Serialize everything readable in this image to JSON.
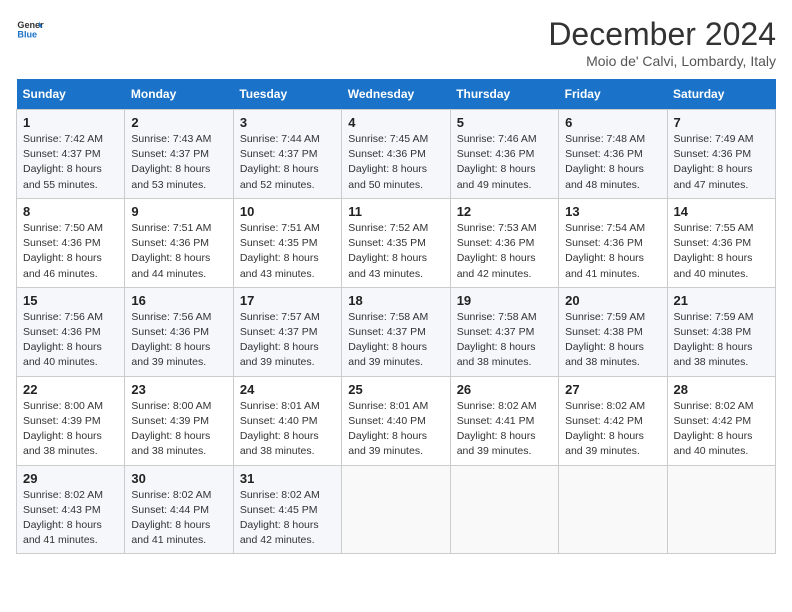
{
  "header": {
    "logo_line1": "General",
    "logo_line2": "Blue",
    "month": "December 2024",
    "location": "Moio de' Calvi, Lombardy, Italy"
  },
  "weekdays": [
    "Sunday",
    "Monday",
    "Tuesday",
    "Wednesday",
    "Thursday",
    "Friday",
    "Saturday"
  ],
  "weeks": [
    [
      {
        "day": "1",
        "sunrise": "7:42 AM",
        "sunset": "4:37 PM",
        "daylight": "8 hours and 55 minutes."
      },
      {
        "day": "2",
        "sunrise": "7:43 AM",
        "sunset": "4:37 PM",
        "daylight": "8 hours and 53 minutes."
      },
      {
        "day": "3",
        "sunrise": "7:44 AM",
        "sunset": "4:37 PM",
        "daylight": "8 hours and 52 minutes."
      },
      {
        "day": "4",
        "sunrise": "7:45 AM",
        "sunset": "4:36 PM",
        "daylight": "8 hours and 50 minutes."
      },
      {
        "day": "5",
        "sunrise": "7:46 AM",
        "sunset": "4:36 PM",
        "daylight": "8 hours and 49 minutes."
      },
      {
        "day": "6",
        "sunrise": "7:48 AM",
        "sunset": "4:36 PM",
        "daylight": "8 hours and 48 minutes."
      },
      {
        "day": "7",
        "sunrise": "7:49 AM",
        "sunset": "4:36 PM",
        "daylight": "8 hours and 47 minutes."
      }
    ],
    [
      {
        "day": "8",
        "sunrise": "7:50 AM",
        "sunset": "4:36 PM",
        "daylight": "8 hours and 46 minutes."
      },
      {
        "day": "9",
        "sunrise": "7:51 AM",
        "sunset": "4:36 PM",
        "daylight": "8 hours and 44 minutes."
      },
      {
        "day": "10",
        "sunrise": "7:51 AM",
        "sunset": "4:35 PM",
        "daylight": "8 hours and 43 minutes."
      },
      {
        "day": "11",
        "sunrise": "7:52 AM",
        "sunset": "4:35 PM",
        "daylight": "8 hours and 43 minutes."
      },
      {
        "day": "12",
        "sunrise": "7:53 AM",
        "sunset": "4:36 PM",
        "daylight": "8 hours and 42 minutes."
      },
      {
        "day": "13",
        "sunrise": "7:54 AM",
        "sunset": "4:36 PM",
        "daylight": "8 hours and 41 minutes."
      },
      {
        "day": "14",
        "sunrise": "7:55 AM",
        "sunset": "4:36 PM",
        "daylight": "8 hours and 40 minutes."
      }
    ],
    [
      {
        "day": "15",
        "sunrise": "7:56 AM",
        "sunset": "4:36 PM",
        "daylight": "8 hours and 40 minutes."
      },
      {
        "day": "16",
        "sunrise": "7:56 AM",
        "sunset": "4:36 PM",
        "daylight": "8 hours and 39 minutes."
      },
      {
        "day": "17",
        "sunrise": "7:57 AM",
        "sunset": "4:37 PM",
        "daylight": "8 hours and 39 minutes."
      },
      {
        "day": "18",
        "sunrise": "7:58 AM",
        "sunset": "4:37 PM",
        "daylight": "8 hours and 39 minutes."
      },
      {
        "day": "19",
        "sunrise": "7:58 AM",
        "sunset": "4:37 PM",
        "daylight": "8 hours and 38 minutes."
      },
      {
        "day": "20",
        "sunrise": "7:59 AM",
        "sunset": "4:38 PM",
        "daylight": "8 hours and 38 minutes."
      },
      {
        "day": "21",
        "sunrise": "7:59 AM",
        "sunset": "4:38 PM",
        "daylight": "8 hours and 38 minutes."
      }
    ],
    [
      {
        "day": "22",
        "sunrise": "8:00 AM",
        "sunset": "4:39 PM",
        "daylight": "8 hours and 38 minutes."
      },
      {
        "day": "23",
        "sunrise": "8:00 AM",
        "sunset": "4:39 PM",
        "daylight": "8 hours and 38 minutes."
      },
      {
        "day": "24",
        "sunrise": "8:01 AM",
        "sunset": "4:40 PM",
        "daylight": "8 hours and 38 minutes."
      },
      {
        "day": "25",
        "sunrise": "8:01 AM",
        "sunset": "4:40 PM",
        "daylight": "8 hours and 39 minutes."
      },
      {
        "day": "26",
        "sunrise": "8:02 AM",
        "sunset": "4:41 PM",
        "daylight": "8 hours and 39 minutes."
      },
      {
        "day": "27",
        "sunrise": "8:02 AM",
        "sunset": "4:42 PM",
        "daylight": "8 hours and 39 minutes."
      },
      {
        "day": "28",
        "sunrise": "8:02 AM",
        "sunset": "4:42 PM",
        "daylight": "8 hours and 40 minutes."
      }
    ],
    [
      {
        "day": "29",
        "sunrise": "8:02 AM",
        "sunset": "4:43 PM",
        "daylight": "8 hours and 41 minutes."
      },
      {
        "day": "30",
        "sunrise": "8:02 AM",
        "sunset": "4:44 PM",
        "daylight": "8 hours and 41 minutes."
      },
      {
        "day": "31",
        "sunrise": "8:02 AM",
        "sunset": "4:45 PM",
        "daylight": "8 hours and 42 minutes."
      },
      null,
      null,
      null,
      null
    ]
  ]
}
